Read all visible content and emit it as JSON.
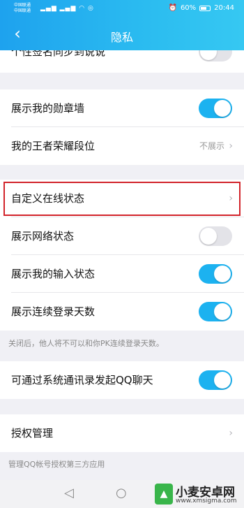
{
  "status_bar": {
    "carrier1": "中国联通",
    "carrier2": "中国联通",
    "battery": "60%",
    "time": "20:44"
  },
  "header": {
    "title": "隐私",
    "back_icon": "chevron-left-icon"
  },
  "rows": [
    {
      "label": "个性签名同步到说说",
      "control": "toggle",
      "on": false
    },
    {
      "label": "展示我的勋章墙",
      "control": "toggle",
      "on": true
    },
    {
      "label": "我的王者荣耀段位",
      "control": "link",
      "value": "不展示"
    },
    {
      "label": "自定义在线状态",
      "control": "link",
      "highlighted": true
    },
    {
      "label": "展示网络状态",
      "control": "toggle",
      "on": false
    },
    {
      "label": "展示我的输入状态",
      "control": "toggle",
      "on": true
    },
    {
      "label": "展示连续登录天数",
      "control": "toggle",
      "on": true
    },
    {
      "label": "可通过系统通讯录发起QQ聊天",
      "control": "toggle",
      "on": true
    },
    {
      "label": "授权管理",
      "control": "link"
    }
  ],
  "notes": {
    "login_days": "关闭后，他人将不可以和你PK连续登录天数。",
    "auth": "管理QQ帐号授权第三方应用"
  },
  "watermark": {
    "title": "小麦安卓网",
    "url": "www.xmsigma.com"
  },
  "colors": {
    "header": "#1ea2ee",
    "toggle_on": "#1cb2f0",
    "highlight_border": "#d2232a"
  }
}
